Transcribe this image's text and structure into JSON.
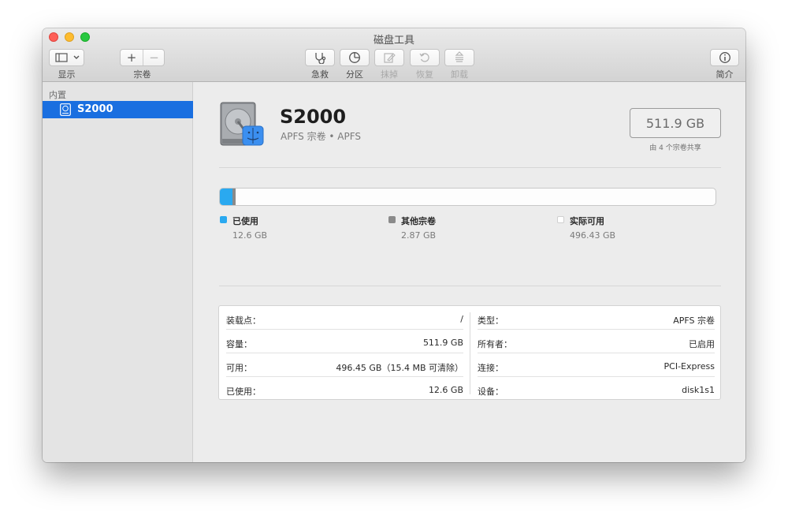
{
  "window": {
    "title": "磁盘工具"
  },
  "toolbar": {
    "display_label": "显示",
    "volume_label": "宗卷",
    "volume_add": "+",
    "volume_remove": "−",
    "first_aid_label": "急救",
    "partition_label": "分区",
    "erase_label": "抹掉",
    "restore_label": "恢复",
    "unmount_label": "卸载",
    "info_label": "简介"
  },
  "sidebar": {
    "section": "内置",
    "items": [
      {
        "label": "S2000",
        "selected": true
      }
    ]
  },
  "volume": {
    "name": "S2000",
    "subtitle": "APFS 宗卷 • APFS",
    "capacity": "511.9 GB",
    "shared_note": "由 4 个宗卷共享"
  },
  "usage": {
    "total_gb": 511.9,
    "used_gb": 12.6,
    "other_gb": 2.87,
    "legend": [
      {
        "name": "已使用",
        "value": "12.6 GB",
        "color": "#2aa9f0"
      },
      {
        "name": "其他宗卷",
        "value": "2.87 GB",
        "color": "#8a8a8a"
      },
      {
        "name": "实际可用",
        "value": "496.43 GB",
        "color": "#ffffff"
      }
    ]
  },
  "info": {
    "left": [
      {
        "key": "装载点：",
        "value": "/"
      },
      {
        "key": "容量：",
        "value": "511.9 GB"
      },
      {
        "key": "可用：",
        "value": "496.45 GB（15.4 MB 可清除）"
      },
      {
        "key": "已使用：",
        "value": "12.6 GB"
      }
    ],
    "right": [
      {
        "key": "类型：",
        "value": "APFS 宗卷"
      },
      {
        "key": "所有者：",
        "value": "已启用"
      },
      {
        "key": "连接：",
        "value": "PCI-Express"
      },
      {
        "key": "设备：",
        "value": "disk1s1"
      }
    ]
  },
  "colors": {
    "accent": "#1a6fe0",
    "used": "#2aa9f0",
    "other": "#8a8a8a"
  }
}
